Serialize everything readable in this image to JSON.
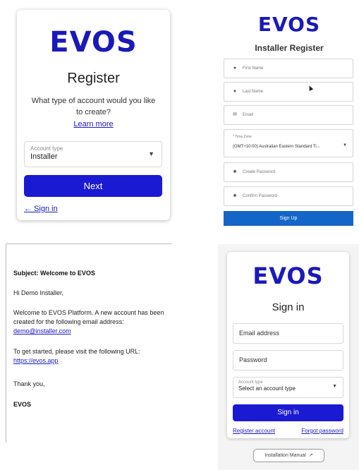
{
  "register": {
    "logo": "EVOS",
    "title": "Register",
    "question": "What type of account would you like to create?",
    "learn_more": "Learn more",
    "account_type_label": "Account type",
    "account_type_value": "Installer",
    "next_label": "Next",
    "sign_in_link": "← Sign in"
  },
  "installer_register": {
    "logo": "EVOS",
    "title": "Installer Register",
    "first_name": "First Name",
    "last_name": "Last Name",
    "email": "Email",
    "time_zone_label": "* Time Zone",
    "time_zone_value": "(GMT+10:00) Australian Eastern Standard Ti...",
    "create_password": "Create Password",
    "confirm_password": "Confirm Password",
    "sign_up_label": "Sign Up"
  },
  "email": {
    "subject": "Subject: Welcome to EVOS",
    "greeting": "Hi Demo Installer,",
    "body1": "Welcome to EVOS Platform. A new account has been created for the following email address:",
    "address": "demo@installer.com",
    "body2": "To get started, please visit the following URL:",
    "url": "https://evos.app",
    "thanks": "Thank you,",
    "signature": "EVOS"
  },
  "sign_in": {
    "logo": "EVOS",
    "title": "Sign in",
    "email_placeholder": "Email address",
    "password_placeholder": "Password",
    "account_type_label": "Account type",
    "account_type_value": "Select an account type",
    "sign_in_label": "Sign in",
    "register_link": "Register account",
    "forgot_link": "Forgot password",
    "manual_label": "Installation Manual"
  },
  "colors": {
    "brand": "#1a1ab8",
    "button": "#1a1ad2",
    "sign_up": "#1565c8"
  },
  "icons": [
    "person-icon",
    "envelope-icon",
    "lock-icon",
    "chevron-down-icon",
    "external-link-icon",
    "mouse-cursor-icon"
  ]
}
